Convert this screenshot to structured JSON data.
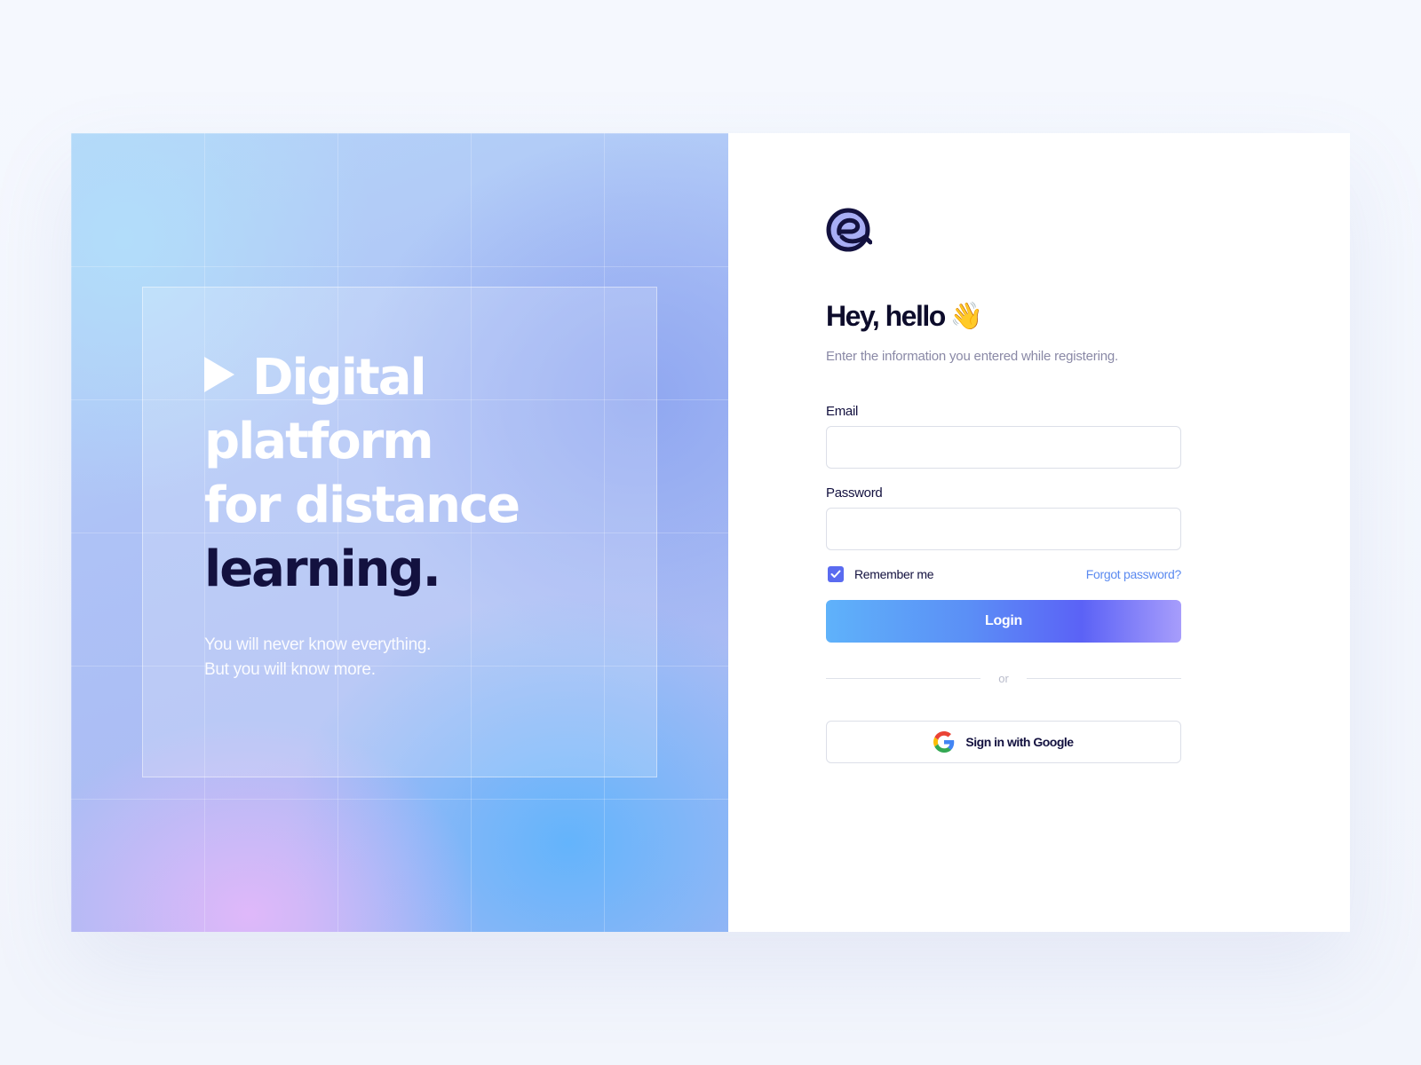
{
  "hero": {
    "headline_line1": "Digital",
    "headline_line2": "platform",
    "headline_line3": "for distance",
    "headline_line4": "learning.",
    "tagline_line1": "You will never know everything.",
    "tagline_line2": "But you will know more."
  },
  "brand": {
    "logo_icon": "brand-logo-icon"
  },
  "form": {
    "greeting": "Hey, hello",
    "greeting_emoji": "👋",
    "subtitle": "Enter the information you entered while registering.",
    "email_label": "Email",
    "email_value": "",
    "email_placeholder": "",
    "password_label": "Password",
    "password_value": "",
    "password_placeholder": "",
    "remember_label": "Remember me",
    "remember_checked": true,
    "forgot_label": "Forgot password?",
    "login_label": "Login",
    "divider_label": "or",
    "google_label": "Sign in with Google"
  },
  "colors": {
    "accent": "#5B62F6",
    "link": "#5B8AF0",
    "text_dark": "#13113F",
    "muted": "#8A89A6"
  }
}
